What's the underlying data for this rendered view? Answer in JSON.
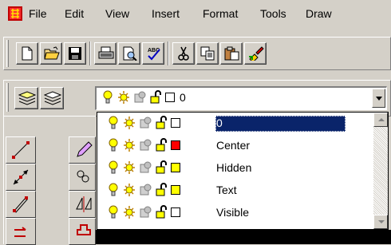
{
  "menubar": {
    "app_icon": "autocad-icon",
    "items": [
      "File",
      "Edit",
      "View",
      "Insert",
      "Format",
      "Tools",
      "Draw"
    ]
  },
  "toolbar": {
    "buttons": [
      "new-icon",
      "open-icon",
      "save-icon",
      "print-icon",
      "print-preview-icon",
      "spelling-icon",
      "cut-icon",
      "copy-icon",
      "paste-icon",
      "match-properties-icon"
    ]
  },
  "layer_toolbar": {
    "current_layer": "0",
    "buttons": [
      "layer-manager-icon",
      "make-object-layer-current-icon"
    ]
  },
  "layer_list": {
    "selected": "0",
    "layers": [
      {
        "name": "0",
        "color": "#ffffff"
      },
      {
        "name": "Center",
        "color": "#ff0000"
      },
      {
        "name": "Hidden",
        "color": "#ffff00"
      },
      {
        "name": "Text",
        "color": "#ffff00"
      },
      {
        "name": "Visible",
        "color": "#ffffff"
      }
    ]
  },
  "colors": {
    "selection": "#0a246a",
    "face": "#d4d0c8"
  }
}
